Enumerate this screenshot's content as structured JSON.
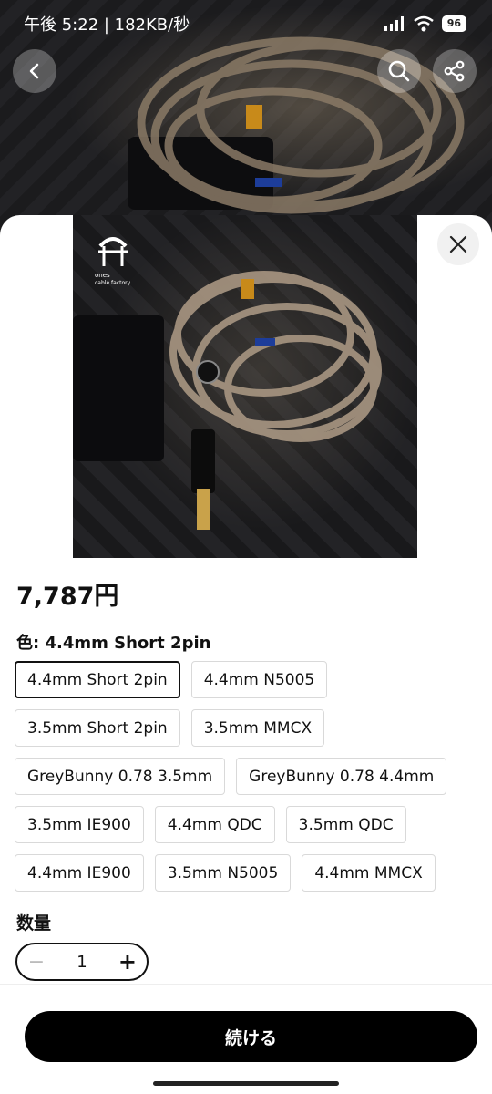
{
  "status_bar": {
    "time": "午後 5:22 | 182KB/秒",
    "battery": "96"
  },
  "header": {
    "back_icon": "chevron-left-icon",
    "search_icon": "search-icon",
    "share_icon": "share-icon"
  },
  "brand": {
    "name": "ones",
    "tagline": "cable factory"
  },
  "product": {
    "price": "7,787円",
    "color_label": "色:",
    "color_value": "4.4mm Short 2pin",
    "options": [
      "4.4mm Short 2pin",
      "4.4mm N5005",
      "3.5mm Short 2pin",
      "3.5mm MMCX",
      "GreyBunny 0.78 3.5mm",
      "GreyBunny 0.78 4.4mm",
      "3.5mm IE900",
      "4.4mm QDC",
      "3.5mm QDC",
      "4.4mm IE900",
      "3.5mm N5005",
      "4.4mm MMCX"
    ],
    "selected_index": 0
  },
  "quantity": {
    "label": "数量",
    "value": "1",
    "minus": "−",
    "plus": "+"
  },
  "footer": {
    "continue_label": "続ける"
  },
  "colors": {
    "accent": "#000000",
    "sheet": "#ffffff",
    "border": "#d9d9d9"
  }
}
